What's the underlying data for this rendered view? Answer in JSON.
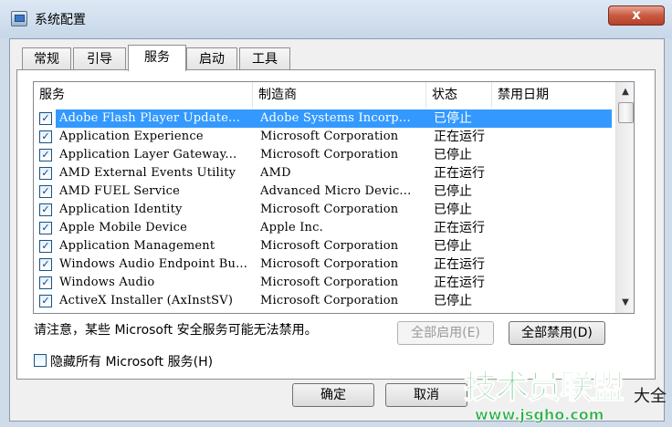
{
  "window": {
    "title": "系统配置",
    "close_label": "x"
  },
  "tabs": [
    {
      "label": "常规"
    },
    {
      "label": "引导"
    },
    {
      "label": "服务",
      "active": true
    },
    {
      "label": "启动"
    },
    {
      "label": "工具"
    }
  ],
  "columns": {
    "service": "服务",
    "manufacturer": "制造商",
    "status": "状态",
    "disable_date": "禁用日期"
  },
  "rows": [
    {
      "service": "Adobe Flash Player Update...",
      "manufacturer": "Adobe Systems Incorp...",
      "status": "已停止",
      "checked": true,
      "selected": true
    },
    {
      "service": "Application Experience",
      "manufacturer": "Microsoft Corporation",
      "status": "正在运行",
      "checked": true
    },
    {
      "service": "Application Layer Gateway...",
      "manufacturer": "Microsoft Corporation",
      "status": "已停止",
      "checked": true
    },
    {
      "service": "AMD External Events Utility",
      "manufacturer": "AMD",
      "status": "正在运行",
      "checked": true
    },
    {
      "service": "AMD FUEL Service",
      "manufacturer": "Advanced Micro Devic...",
      "status": "已停止",
      "checked": true
    },
    {
      "service": "Application Identity",
      "manufacturer": "Microsoft Corporation",
      "status": "已停止",
      "checked": true
    },
    {
      "service": "Apple Mobile Device",
      "manufacturer": "Apple Inc.",
      "status": "正在运行",
      "checked": true
    },
    {
      "service": "Application Management",
      "manufacturer": "Microsoft Corporation",
      "status": "已停止",
      "checked": true
    },
    {
      "service": "Windows Audio Endpoint Bu...",
      "manufacturer": "Microsoft Corporation",
      "status": "正在运行",
      "checked": true
    },
    {
      "service": "Windows Audio",
      "manufacturer": "Microsoft Corporation",
      "status": "正在运行",
      "checked": true
    },
    {
      "service": "ActiveX Installer (AxInstSV)",
      "manufacturer": "Microsoft Corporation",
      "status": "已停止",
      "checked": true
    }
  ],
  "note": "请注意，某些 Microsoft 安全服务可能无法禁用。",
  "buttons": {
    "enable_all": "全部启用(E)",
    "disable_all": "全部禁用(D)",
    "ok": "确定",
    "cancel": "取消"
  },
  "hide_ms": {
    "label": "隐藏所有 Microsoft 服务(H)",
    "checked": false
  },
  "watermark": {
    "main": "技术员联盟",
    "url": "www.jsgho.com",
    "side": "大全"
  },
  "colors": {
    "selection": "#3399ff",
    "watermark": "#2db14a"
  }
}
